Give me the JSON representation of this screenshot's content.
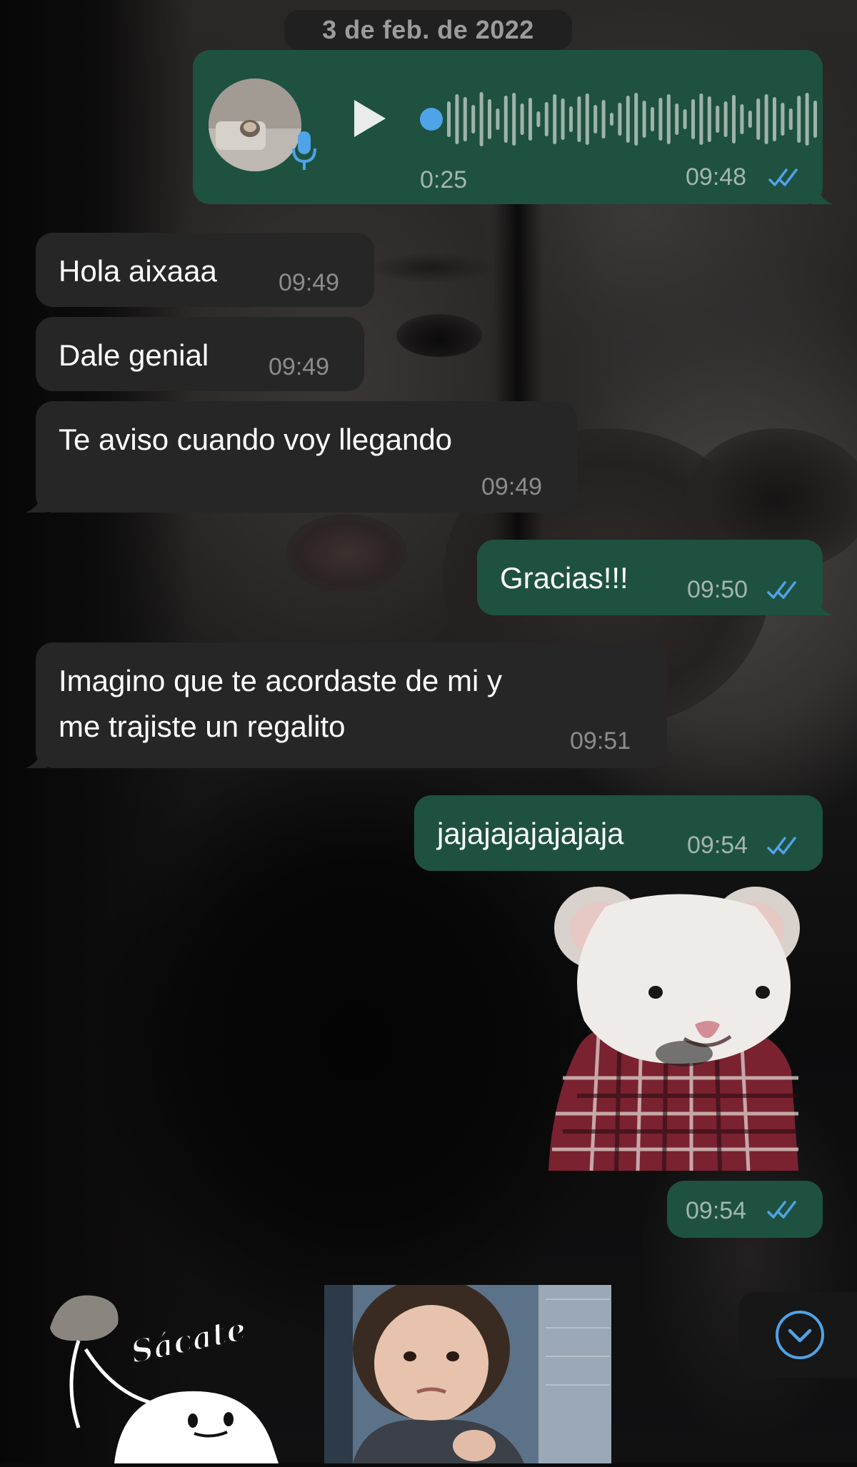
{
  "chat": {
    "date_chip": "3 de feb. de 2022",
    "messages": [
      {
        "id": "voice",
        "direction": "out",
        "type": "voice",
        "duration": "0:25",
        "time": "09:48",
        "status": "read"
      },
      {
        "id": "m1",
        "direction": "in",
        "text": "Hola aixaaa",
        "time": "09:49"
      },
      {
        "id": "m2",
        "direction": "in",
        "text": "Dale genial",
        "time": "09:49"
      },
      {
        "id": "m3",
        "direction": "in",
        "text": "Te aviso cuando voy llegando",
        "time": "09:49"
      },
      {
        "id": "m4",
        "direction": "out",
        "text": "Gracias!!!",
        "time": "09:50",
        "status": "read"
      },
      {
        "id": "m5",
        "direction": "in",
        "text_line1": "Imagino que te acordaste de mi y",
        "text_line2": "me trajiste un regalito",
        "time": "09:51"
      },
      {
        "id": "m6",
        "direction": "out",
        "text": "jajajajajajajaja",
        "time": "09:54",
        "status": "read"
      },
      {
        "id": "sticker1",
        "direction": "out",
        "type": "sticker",
        "subject": "mouse in plaid shirt",
        "time": "09:54",
        "status": "read"
      },
      {
        "id": "sticker2",
        "direction": "in",
        "type": "sticker",
        "subject": "cartoon blob",
        "caption": "Sácate"
      },
      {
        "id": "sticker3",
        "direction": "in",
        "type": "sticker",
        "subject": "child photo"
      }
    ]
  },
  "icons": {
    "play": "play-icon",
    "mic": "microphone-icon",
    "ticks": "double-check-icon",
    "scroll_down": "chevron-down-circle-icon"
  },
  "colors": {
    "outgoing_bubble": "#1e5140",
    "incoming_bubble": "#262626",
    "read_ticks": "#4fa3e8",
    "accent_blue": "#4fa3e8"
  }
}
